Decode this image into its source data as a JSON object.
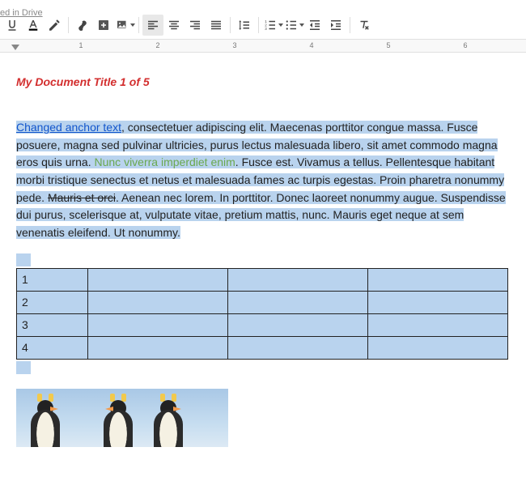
{
  "header": {
    "saved_label": "ed in Drive"
  },
  "ruler": {
    "ticks": [
      "1",
      "2",
      "3",
      "4",
      "5",
      "6"
    ]
  },
  "document": {
    "title": "My Document Title 1 of 5",
    "paragraph": {
      "anchor": "Changed anchor text",
      "seg1": ", consectetuer adipiscing elit. Maecenas porttitor congue massa. Fusce posuere, magna sed pulvinar ultricies, purus lectus malesuada libero, sit amet commodo magna eros quis urna. ",
      "green": "Nunc viverra imperdiet enim",
      "seg2": ". Fusce est. Vivamus a tellus. Pellentesque habitant morbi tristique senectus et netus et malesuada fames ac turpis egestas. Proin pharetra nonummy pede. ",
      "struck": "Mauris et orci",
      "seg3": ". Aenean nec lorem. In porttitor. Donec laoreet nonummy augue. Suspendisse dui purus, scelerisque at, vulputate vitae, pretium mattis, nunc. Mauris eget neque at sem venenatis eleifend. Ut nonummy."
    },
    "table": {
      "rows": [
        {
          "c0": "1",
          "c1": "",
          "c2": "",
          "c3": ""
        },
        {
          "c0": "2",
          "c1": "",
          "c2": "",
          "c3": ""
        },
        {
          "c0": "3",
          "c1": "",
          "c2": "",
          "c3": ""
        },
        {
          "c0": "4",
          "c1": "",
          "c2": "",
          "c3": ""
        }
      ]
    }
  },
  "toolbar": {
    "icons": {
      "underline": "underline-icon",
      "text_color": "text-color-icon",
      "highlight": "highlight-icon",
      "link": "link-icon",
      "add_comment": "add-comment-icon",
      "image": "image-icon",
      "align_left": "align-left-icon",
      "align_center": "align-center-icon",
      "align_right": "align-right-icon",
      "align_justify": "align-justify-icon",
      "line_spacing": "line-spacing-icon",
      "numbered_list": "numbered-list-icon",
      "bulleted_list": "bulleted-list-icon",
      "indent_decrease": "indent-decrease-icon",
      "indent_increase": "indent-increase-icon",
      "clear_formatting": "clear-formatting-icon"
    }
  },
  "colors": {
    "selection": "#b9d3ee",
    "title": "#d32f2f",
    "link": "#1155cc",
    "green_text": "#6aa84f"
  }
}
